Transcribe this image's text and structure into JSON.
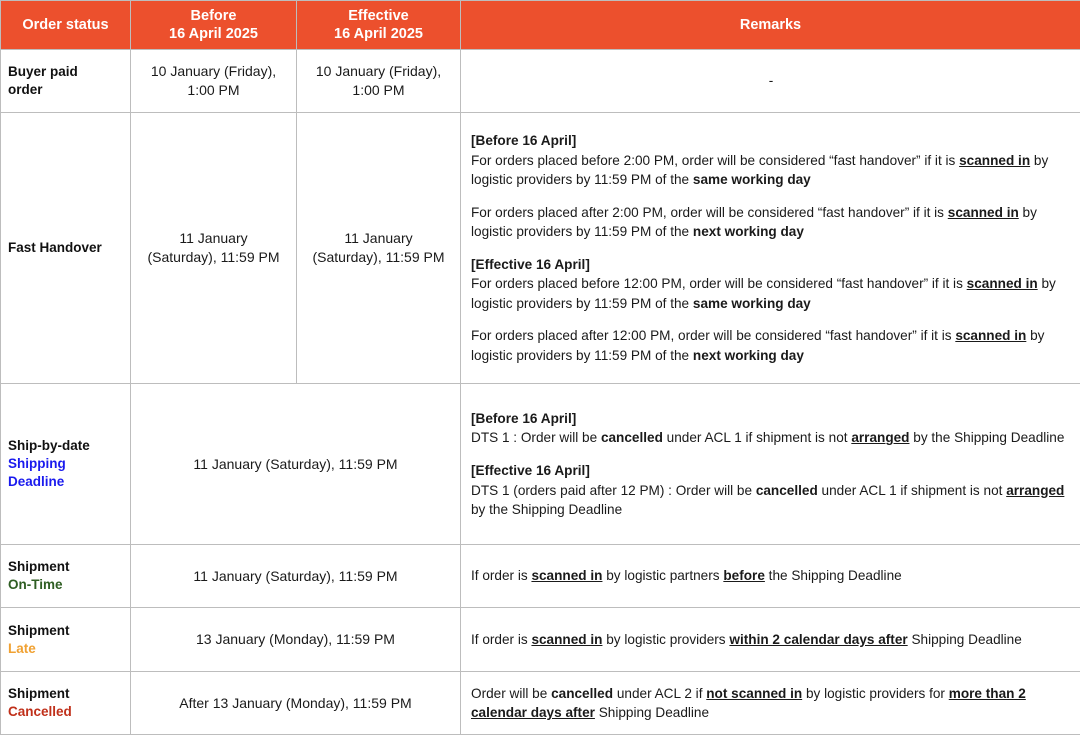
{
  "table": {
    "headers": {
      "order_status": "Order status",
      "before_line1": "Before",
      "before_line2": "16 April 2025",
      "effective_line1": "Effective",
      "effective_line2": "16 April 2025",
      "remarks": "Remarks"
    },
    "colors": {
      "header_background": "#EC502D",
      "header_text": "#FFFFFF",
      "blue_label": "#1A1AEE",
      "green_label": "#2F5E23",
      "orange_label": "#F0A132",
      "red_label": "#C0301A",
      "grid_line": "#BDBDBD",
      "bottom_rule": "#000000"
    },
    "rows": [
      {
        "status_main": "Buyer paid",
        "status_main2": "order",
        "status_sub": "",
        "before": "10 January (Friday),\n1:00 PM",
        "before_line1": "10 January (Friday),",
        "before_line2": "1:00 PM",
        "effective_line1": "10 January (Friday),",
        "effective_line2": "1:00 PM",
        "remarks_dash": "-"
      },
      {
        "status_main": "Fast Handover",
        "before_line1": "11 January",
        "before_line2": "(Saturday), 11:59 PM",
        "effective_line1": "11 January",
        "effective_line2": "(Saturday), 11:59 PM",
        "remarks": {
          "before_heading": "[Before 16 April]",
          "before_p1_a": "For orders placed before 2:00 PM, order will be considered “fast handover” if it is ",
          "before_p1_u": "scanned in",
          "before_p1_b": " by logistic providers by 11:59 PM of the ",
          "before_p1_bold": "same working day",
          "before_p2_a": "For orders placed after 2:00 PM, order will be considered “fast handover” if it is ",
          "before_p2_u": "scanned in",
          "before_p2_b": " by logistic providers by 11:59 PM of the ",
          "before_p2_bold": "next working day",
          "effective_heading": "[Effective 16 April]",
          "eff_p1_a": "For orders placed before 12:00 PM, order will be considered “fast handover” if it is ",
          "eff_p1_u": "scanned in",
          "eff_p1_b": " by logistic providers by 11:59 PM of the ",
          "eff_p1_bold": "same working day",
          "eff_p2_a": "For orders placed after 12:00 PM, order will be considered “fast handover” if it is ",
          "eff_p2_u": "scanned in",
          "eff_p2_b": " by logistic providers by 11:59 PM of the ",
          "eff_p2_bold": "next working day"
        }
      },
      {
        "status_main": "Ship-by-date",
        "status_sub1": "Shipping",
        "status_sub2": "Deadline",
        "status_sub_color": "blue",
        "merged_date": "11 January (Saturday), 11:59 PM",
        "remarks": {
          "before_heading": "[Before 16 April]",
          "before_a": "DTS 1 : Order will be ",
          "before_bold1": "cancelled",
          "before_b": " under ACL 1 if shipment is not ",
          "before_u": "arranged",
          "before_c": " by the Shipping Deadline",
          "effective_heading": "[Effective 16 April]",
          "eff_a": "DTS 1 (orders paid after 12 PM) : Order will be ",
          "eff_bold1": "cancelled",
          "eff_b": " under ACL 1 if shipment is not ",
          "eff_u": "arranged",
          "eff_c": " by the Shipping Deadline"
        }
      },
      {
        "status_main": "Shipment",
        "status_sub": "On-Time",
        "status_sub_color": "green",
        "merged_date": "11 January (Saturday), 11:59 PM",
        "remarks": {
          "a": "If order is ",
          "u1": "scanned in",
          "b": " by logistic partners ",
          "u2": "before",
          "c": " the Shipping Deadline"
        }
      },
      {
        "status_main": "Shipment",
        "status_sub": "Late",
        "status_sub_color": "orange",
        "merged_date": "13 January (Monday), 11:59 PM",
        "remarks": {
          "a": "If order is ",
          "u1": "scanned in",
          "b": " by logistic providers ",
          "u2": "within 2 calendar days after",
          "c": " Shipping Deadline"
        }
      },
      {
        "status_main": "Shipment",
        "status_sub": "Cancelled",
        "status_sub_color": "red",
        "merged_date": "After 13 January (Monday), 11:59 PM",
        "remarks": {
          "a": "Order will be ",
          "bold1": "cancelled",
          "b": " under ACL 2 if ",
          "u1": "not scanned in",
          "c": " by logistic providers for ",
          "u2": "more than 2 calendar days after",
          "d": " Shipping Deadline"
        }
      }
    ]
  }
}
